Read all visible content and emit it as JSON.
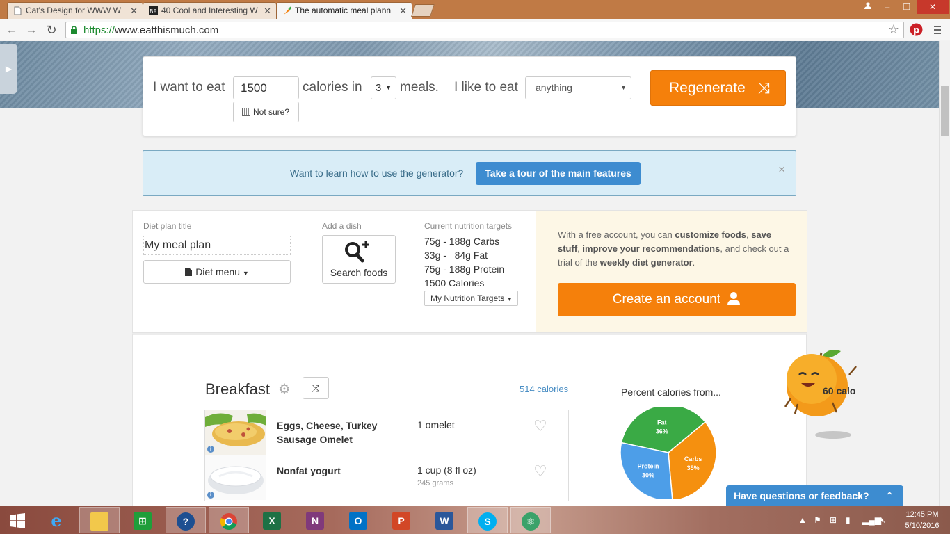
{
  "browser": {
    "tabs": [
      {
        "title": "Cat's Design for WWW W"
      },
      {
        "title": "40 Cool and Interesting W"
      },
      {
        "title": "The automatic meal plann"
      }
    ],
    "url_scheme": "https://",
    "url_rest": "www.eatthismuch.com"
  },
  "generator": {
    "text_want": "I want to eat",
    "calories_value": "1500",
    "text_calories_in": "calories in",
    "meals_value": "3",
    "text_meals": "meals.",
    "text_like": "I like to eat",
    "food_pref": "anything",
    "not_sure": "Not sure?",
    "regenerate": "Regenerate"
  },
  "tour": {
    "prompt": "Want to learn how to use the generator?",
    "button": "Take a tour of the main features",
    "close": "×"
  },
  "plan": {
    "title_label": "Diet plan title",
    "title_value": "My meal plan",
    "diet_menu": "Diet menu",
    "add_dish_label": "Add a dish",
    "search_foods": "Search foods",
    "targets_label": "Current nutrition targets",
    "targets": [
      "75g - 188g Carbs",
      "33g -   84g Fat",
      "75g - 188g Protein",
      "1500 Calories"
    ],
    "targets_button": "My Nutrition Targets"
  },
  "promo": {
    "p1": "With a free account, you can ",
    "b1": "customize foods",
    "p2": ", ",
    "b2": "save stuff",
    "p3": ", ",
    "b3": "improve your recommendations",
    "p4": ", and check out a trial of the ",
    "b4": "weekly diet generator",
    "p5": ".",
    "create_account": "Create an account"
  },
  "breakfast": {
    "title": "Breakfast",
    "calories": "514 calories",
    "foods": [
      {
        "name": "Eggs, Cheese, Turkey Sausage Omelet",
        "amount": "1 omelet",
        "sub": ""
      },
      {
        "name": "Nonfat yogurt",
        "amount": "1 cup (8 fl oz)",
        "sub": "245 grams"
      }
    ]
  },
  "chart_data": {
    "type": "pie",
    "title": "Percent calories from...",
    "slices": [
      {
        "name": "Fat",
        "percent": 36,
        "label": "36%",
        "color": "#3aaa45"
      },
      {
        "name": "Carbs",
        "percent": 35,
        "label": "35%",
        "color": "#f5900f"
      },
      {
        "name": "Protein",
        "percent": 30,
        "label": "30%",
        "color": "#4d9ee8"
      }
    ]
  },
  "mascot": {
    "label": "60 calo"
  },
  "feedback": {
    "label": "Have questions or feedback?"
  },
  "taskbar": {
    "time": "12:45 PM",
    "date": "5/10/2016",
    "apps": [
      "start",
      "internet-explorer",
      "file-explorer",
      "store",
      "help",
      "chrome",
      "excel",
      "onenote",
      "outlook",
      "powerpoint",
      "word",
      "skype",
      "atom"
    ]
  },
  "colors": {
    "accent_orange": "#f5800b",
    "tour_blue": "#3d8cd0",
    "link_blue": "#4a8ec4"
  }
}
